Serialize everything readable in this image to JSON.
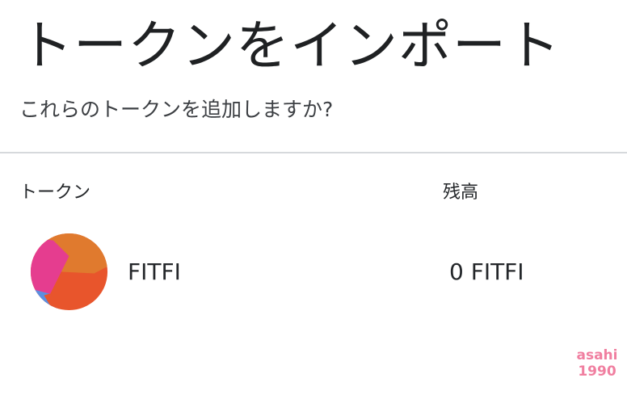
{
  "header": {
    "title": "トークンをインポート",
    "subtitle": "これらのトークンを追加しますか?"
  },
  "table": {
    "columns": [
      "トークン",
      "残高"
    ],
    "rows": [
      {
        "symbol": "FITFI",
        "balance": "0 FITFI",
        "icon": "fitfi-token-icon"
      }
    ]
  },
  "watermark": {
    "line1": "asahi",
    "line2": "1990"
  },
  "colors": {
    "divider": "#d6d9dc",
    "text": "#24272a",
    "icon_orange": "#e07a2e",
    "icon_red": "#e8552c",
    "icon_pink": "#e53d8f",
    "icon_blue": "#5b8fe0",
    "watermark": "#f07fa0"
  }
}
